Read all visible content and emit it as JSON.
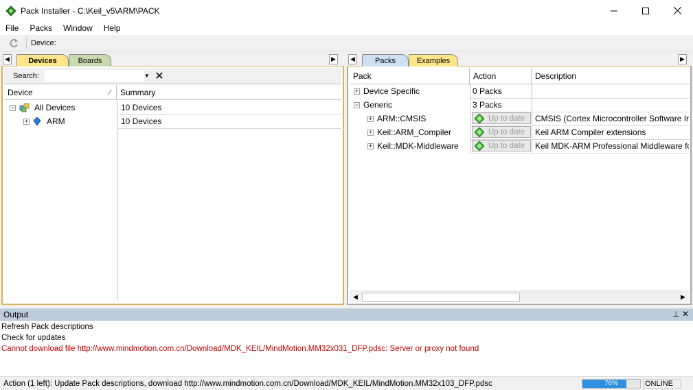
{
  "window": {
    "title": "Pack Installer - C:\\Keil_v5\\ARM\\PACK",
    "minimize_glyph": "—",
    "maximize_glyph": "☐",
    "close_glyph": "✕"
  },
  "menu": [
    "File",
    "Packs",
    "Window",
    "Help"
  ],
  "toolbar": {
    "device_label": "Device:"
  },
  "left_panel": {
    "tabs": [
      {
        "label": "Devices",
        "active": true
      },
      {
        "label": "Boards",
        "active": false
      }
    ],
    "search": {
      "label": "Search:",
      "value": ""
    },
    "columns": [
      "Device",
      "Summary"
    ],
    "rows": [
      {
        "name": "All Devices",
        "summary": "10 Devices",
        "expander": "−",
        "icon": "devices-icon"
      },
      {
        "name": "ARM",
        "summary": "10 Devices",
        "expander": "+",
        "icon": "arm-chip-icon"
      }
    ]
  },
  "right_panel": {
    "tabs": [
      {
        "label": "Packs",
        "active": true
      },
      {
        "label": "Examples",
        "active": false
      }
    ],
    "columns": [
      "Pack",
      "Action",
      "Description"
    ],
    "rows": [
      {
        "name": "Device Specific",
        "action": "0 Packs",
        "description": "",
        "expander": "+",
        "level": 0
      },
      {
        "name": "Generic",
        "action": "3 Packs",
        "description": "",
        "expander": "−",
        "level": 0
      },
      {
        "name": "ARM::CMSIS",
        "action": "Up to date",
        "description": "CMSIS (Cortex Microcontroller Software Interface Standard)",
        "expander": "+",
        "level": 1,
        "button": true
      },
      {
        "name": "Keil::ARM_Compiler",
        "action": "Up to date",
        "description": "Keil ARM Compiler extensions",
        "expander": "+",
        "level": 1,
        "button": true
      },
      {
        "name": "Keil::MDK-Middleware",
        "action": "Up to date",
        "description": "Keil MDK-ARM Professional Middleware for ARM Cortex-M",
        "expander": "+",
        "level": 1,
        "button": true
      }
    ]
  },
  "output": {
    "title": "Output",
    "pin_glyph": "⊥",
    "close_glyph": "✕",
    "lines": [
      {
        "text": "Refresh Pack descriptions",
        "color": "#000000"
      },
      {
        "text": "Check for updates",
        "color": "#000000"
      },
      {
        "text": "Cannot download file http://www.mindmotion.com.cn/Download/MDK_KEIL/MindMotion.MM32x031_DFP.pdsc: Server or proxy not found",
        "color": "#c00000"
      }
    ]
  },
  "status": {
    "text": "Action (1 left): Update Pack descriptions, download http://www.mindmotion.com.cn/Download/MDK_KEIL/MindMotion.MM32x103_DFP.pdsc",
    "progress_percent": 76,
    "progress_label": "76%",
    "connection": "ONLINE"
  },
  "colors": {
    "tab_active": "#ffe58a",
    "tab_boards": "#c8dab0",
    "tab_packs": "#cfe0f3",
    "panel_border": "#d8b25a",
    "output_header": "#bfcddb",
    "error_text": "#c00000",
    "progress": "#2f8fe0"
  }
}
